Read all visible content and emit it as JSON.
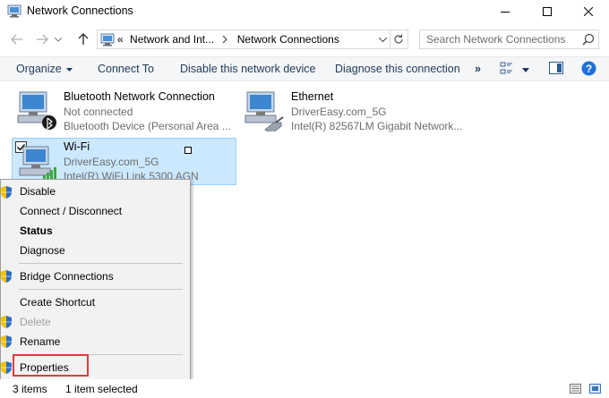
{
  "window": {
    "title": "Network Connections"
  },
  "address": {
    "prefix": "«",
    "crumbs": [
      "Network and Int...",
      "Network Connections"
    ]
  },
  "search": {
    "placeholder": "Search Network Connections"
  },
  "commands": {
    "organize": "Organize",
    "connect": "Connect To",
    "disable": "Disable this network device",
    "diagnose": "Diagnose this connection",
    "more": "»"
  },
  "items": [
    {
      "name": "Bluetooth Network Connection",
      "status": "Not connected",
      "device": "Bluetooth Device (Personal Area ..."
    },
    {
      "name": "Ethernet",
      "status": "DriverEasy.com_5G",
      "device": "Intel(R) 82567LM Gigabit Network..."
    },
    {
      "name": "Wi-Fi",
      "status": "DriverEasy.com_5G",
      "device": "Intel(R) WiFi Link 5300 AGN"
    }
  ],
  "context_menu": {
    "disable": "Disable",
    "connect_disconnect": "Connect / Disconnect",
    "status": "Status",
    "diagnose": "Diagnose",
    "bridge": "Bridge Connections",
    "shortcut": "Create Shortcut",
    "delete": "Delete",
    "rename": "Rename",
    "properties": "Properties"
  },
  "statusbar": {
    "count": "3 items",
    "selected": "1 item selected"
  },
  "colors": {
    "selection": "#cce8ff",
    "highlight": "#e03c3c",
    "help": "#1e6fd9"
  }
}
